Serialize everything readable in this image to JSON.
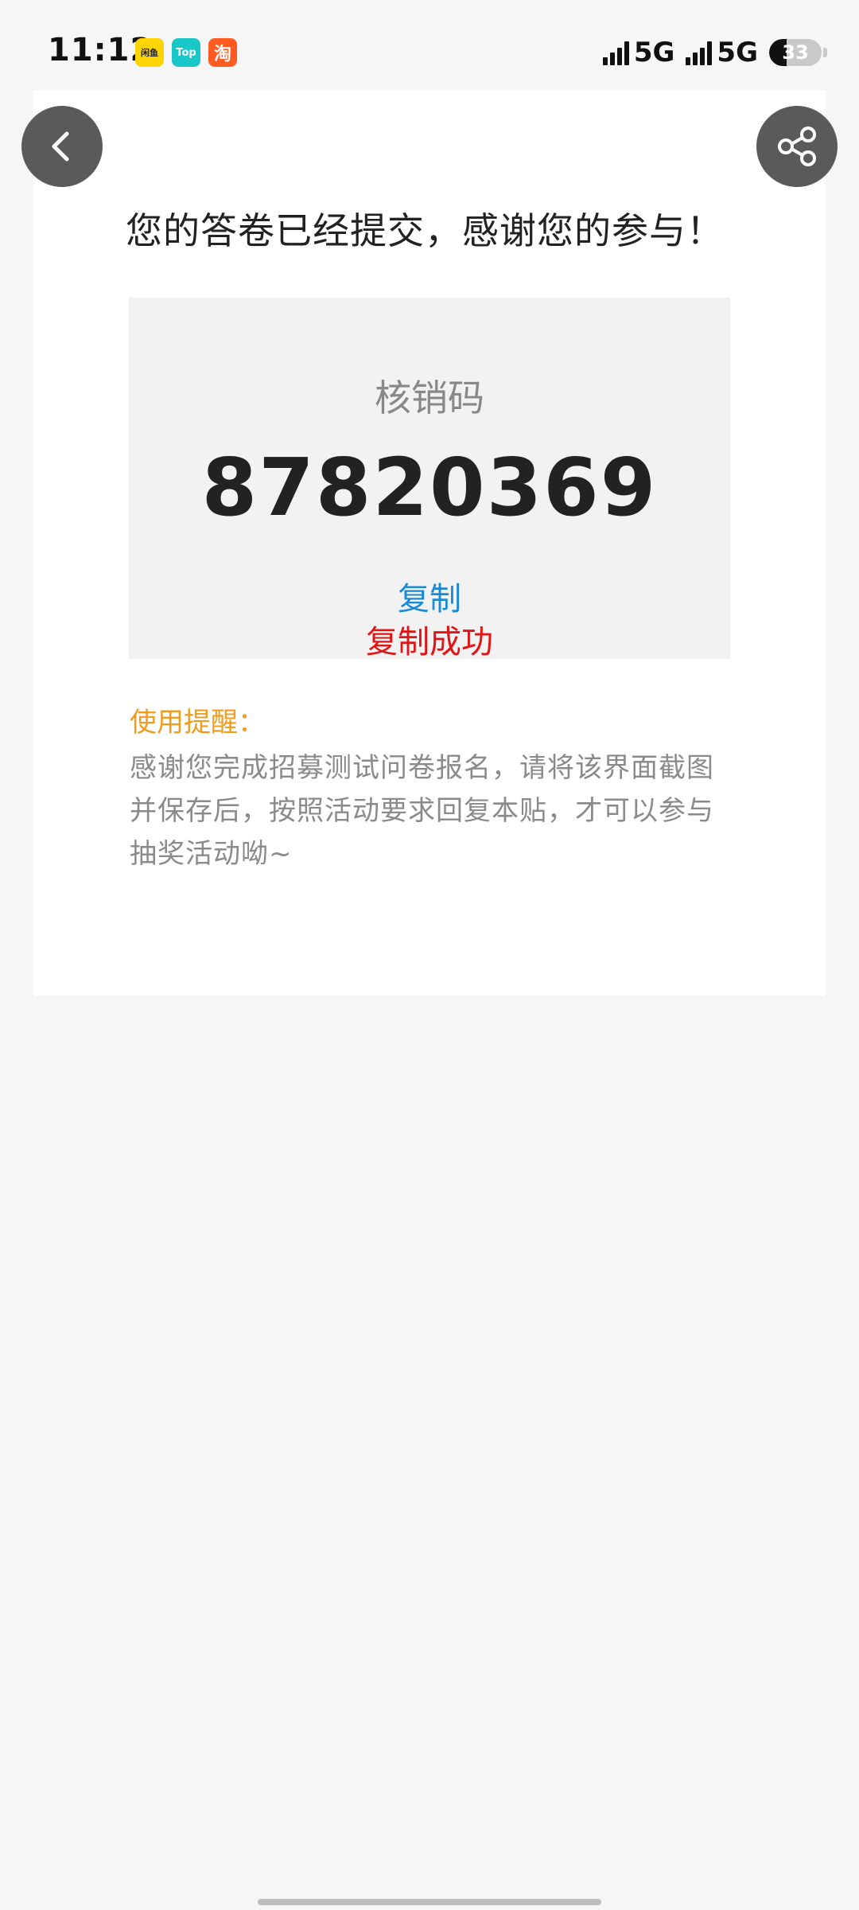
{
  "status_bar": {
    "time": "11:12",
    "app_icons": [
      {
        "name": "app-icon-1",
        "text": "闲鱼"
      },
      {
        "name": "app-icon-2",
        "text": "Top"
      },
      {
        "name": "app-icon-3",
        "text": "淘"
      }
    ],
    "network_1": "5G",
    "network_2": "5G",
    "battery": "33",
    "battery_level": 0.33
  },
  "page": {
    "headline": "您的答卷已经提交，感谢您的参与！",
    "code_label": "核销码",
    "code_value": "87820369",
    "copy_label": "复制",
    "copy_status": "复制成功",
    "tip_title": "使用提醒：",
    "tip_body": "感谢您完成招募测试问卷报名，请将该界面截图并保存后，按照活动要求回复本贴，才可以参与抽奖活动呦~"
  },
  "icons": {
    "back": "chevron-left-icon",
    "share": "share-icon"
  },
  "colors": {
    "copy": "#1a8ad4",
    "success": "#e01515",
    "tip_title": "#f09c1f"
  }
}
